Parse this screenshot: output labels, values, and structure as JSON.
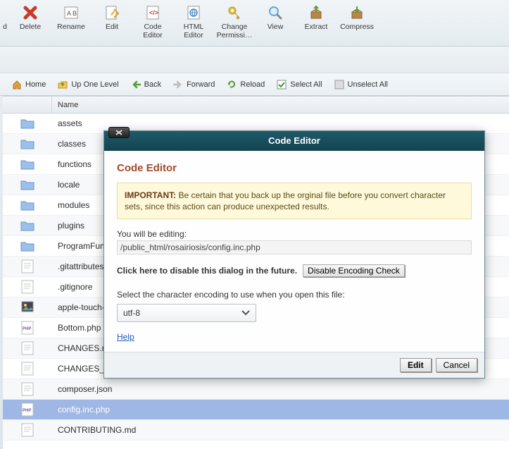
{
  "toolbar": [
    {
      "label": "Delete",
      "icon": "delete"
    },
    {
      "label": "Rename",
      "icon": "rename"
    },
    {
      "label": "Edit",
      "icon": "edit"
    },
    {
      "label": "Code Editor",
      "icon": "code"
    },
    {
      "label": "HTML Editor",
      "icon": "html"
    },
    {
      "label": "Change Permissi…",
      "icon": "perm"
    },
    {
      "label": "View",
      "icon": "view"
    },
    {
      "label": "Extract",
      "icon": "extract"
    },
    {
      "label": "Compress",
      "icon": "compress"
    }
  ],
  "nav": {
    "home": "Home",
    "up": "Up One Level",
    "back": "Back",
    "forward": "Forward",
    "reload": "Reload",
    "selectall": "Select All",
    "unselectall": "Unselect All"
  },
  "list": {
    "header_name": "Name",
    "rows": [
      {
        "name": "assets",
        "type": "folder"
      },
      {
        "name": "classes",
        "type": "folder"
      },
      {
        "name": "functions",
        "type": "folder"
      },
      {
        "name": "locale",
        "type": "folder"
      },
      {
        "name": "modules",
        "type": "folder"
      },
      {
        "name": "plugins",
        "type": "folder"
      },
      {
        "name": "ProgramFun",
        "type": "folder"
      },
      {
        "name": ".gitattributes",
        "type": "file"
      },
      {
        "name": ".gitignore",
        "type": "file"
      },
      {
        "name": "apple-touch-",
        "type": "image"
      },
      {
        "name": "Bottom.php",
        "type": "php"
      },
      {
        "name": "CHANGES.m",
        "type": "file"
      },
      {
        "name": "CHANGES_",
        "type": "file"
      },
      {
        "name": "composer.json",
        "type": "file"
      },
      {
        "name": "config.inc.php",
        "type": "php",
        "selected": true
      },
      {
        "name": "CONTRIBUTING.md",
        "type": "file"
      }
    ]
  },
  "modal": {
    "title": "Code Editor",
    "subtitle": "Code Editor",
    "important_label": "IMPORTANT:",
    "important_text": "Be certain that you back up the orginal file before you convert character sets, since this action can produce unexpected results.",
    "editing_label": "You will be editing:",
    "editing_path": "/public_html/rosairiosis/config.inc.php",
    "disable_text": "Click here to disable this dialog in the future.",
    "disable_btn": "Disable Encoding Check",
    "encoding_label": "Select the character encoding to use when you open this file:",
    "encoding_value": "utf-8",
    "help": "Help",
    "edit": "Edit",
    "cancel": "Cancel"
  }
}
